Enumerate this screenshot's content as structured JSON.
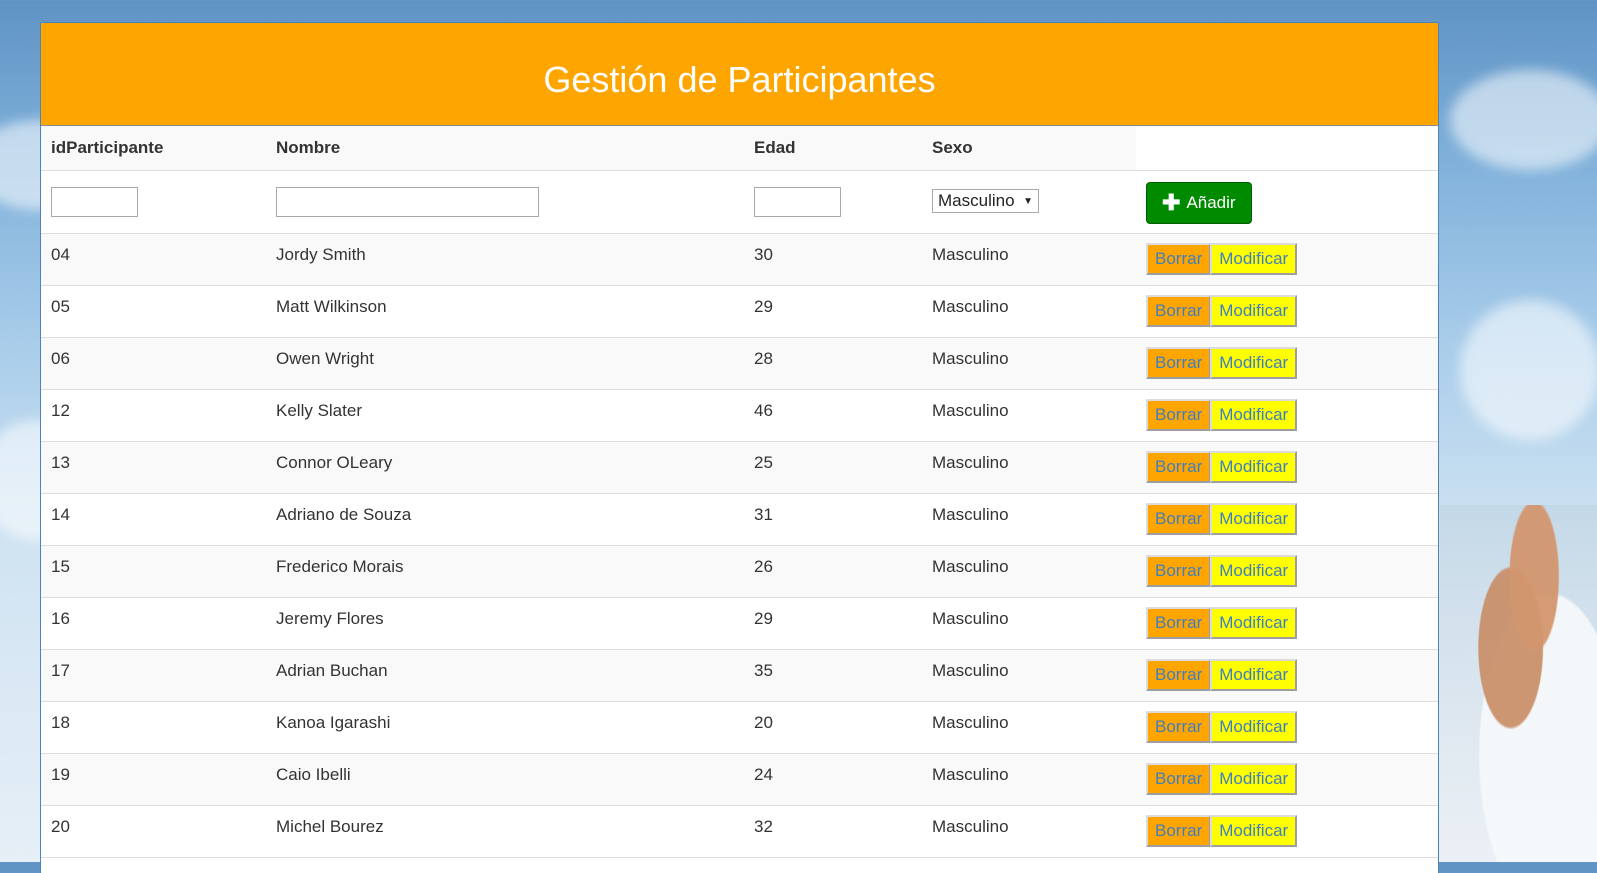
{
  "header": {
    "title": "Gestión de Participantes"
  },
  "columns": [
    "idParticipante",
    "Nombre",
    "Edad",
    "Sexo"
  ],
  "form": {
    "id_value": "",
    "name_value": "",
    "age_value": "",
    "sex_selected": "Masculino",
    "add_label": "Añadir"
  },
  "actions": {
    "delete_label": "Borrar",
    "modify_label": "Modificar"
  },
  "participants": [
    {
      "id": "04",
      "name": "Jordy Smith",
      "age": "30",
      "sex": "Masculino"
    },
    {
      "id": "05",
      "name": "Matt Wilkinson",
      "age": "29",
      "sex": "Masculino"
    },
    {
      "id": "06",
      "name": "Owen Wright",
      "age": "28",
      "sex": "Masculino"
    },
    {
      "id": "12",
      "name": "Kelly Slater",
      "age": "46",
      "sex": "Masculino"
    },
    {
      "id": "13",
      "name": "Connor OLeary",
      "age": "25",
      "sex": "Masculino"
    },
    {
      "id": "14",
      "name": "Adriano de Souza",
      "age": "31",
      "sex": "Masculino"
    },
    {
      "id": "15",
      "name": "Frederico Morais",
      "age": "26",
      "sex": "Masculino"
    },
    {
      "id": "16",
      "name": "Jeremy Flores",
      "age": "29",
      "sex": "Masculino"
    },
    {
      "id": "17",
      "name": "Adrian Buchan",
      "age": "35",
      "sex": "Masculino"
    },
    {
      "id": "18",
      "name": "Kanoa Igarashi",
      "age": "20",
      "sex": "Masculino"
    },
    {
      "id": "19",
      "name": "Caio Ibelli",
      "age": "24",
      "sex": "Masculino"
    },
    {
      "id": "20",
      "name": "Michel Bourez",
      "age": "32",
      "sex": "Masculino"
    }
  ],
  "colors": {
    "header_bg": "#ffa500",
    "add_button_bg": "#008a00",
    "delete_button_bg": "#ffa500",
    "modify_button_bg": "#ffff00",
    "action_text": "#3f7fbf"
  }
}
